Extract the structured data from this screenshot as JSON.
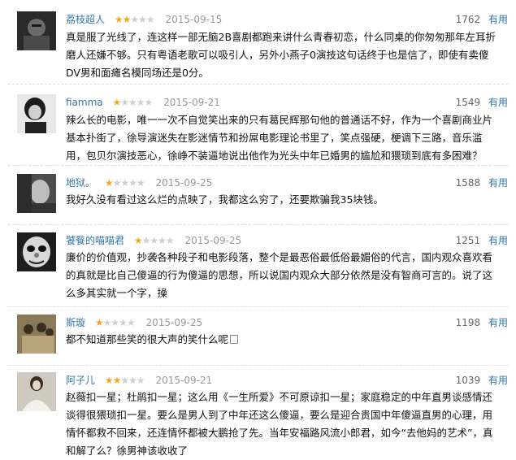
{
  "reviews": [
    {
      "user": "荔枝超人",
      "rating": 2,
      "date": "2015-09-15",
      "votes": "1762",
      "useful": "有用",
      "text": "真是服了光线了，连这样一部无脑2B喜剧都跑来讲什么青春初恋，什么同桌的你匆匆那年左耳折磨人还嫌不够。只有粤语老歌可以吸引人，另外小燕子0演技这句话终于也是信了，即使有卖傻DV男和面瘫名模同场还是0分。"
    },
    {
      "user": "fiamma",
      "rating": 1,
      "date": "2015-09-21",
      "votes": "1549",
      "useful": "有用",
      "text": "辣么长的电影，唯一一次不自觉笑出来的只有葛民辉那句他的普通话不好，作为一个喜剧商业片基本扑街了，徐导演迷失在影迷情节和扮屌电影理论书里了，笑点强硬，梗调下三路，音乐滥用，包贝尔演技恶心，徐峥不装逼地说出他作为光头中年已婚男的尴尬和猥琐到底有多困难？"
    },
    {
      "user": "地狱。",
      "rating": 1,
      "date": "2015-09-25",
      "votes": "1588",
      "useful": "有用",
      "text": "我好久没有看过这么烂的点映了，我都这么穷了，还要欺骗我35块钱。"
    },
    {
      "user": "饕餮的喵喵君",
      "rating": 1,
      "date": "2015-09-25",
      "votes": "1251",
      "useful": "有用",
      "text": "廉价的价值观，抄袭各种段子和电影段落，整个是最恶俗最低俗最媚俗的代言，国内观众喜欢看的真就是比自己傻逼的行为傻逼的思想，所以说国内观众大部分依然是没有智商可言的。说了这么多其实就一个字，操"
    },
    {
      "user": "斯璇",
      "rating": 1,
      "date": "2015-09-25",
      "votes": "1198",
      "useful": "有用",
      "text": "都不知道那些笑的很大声的笑什么呢"
    },
    {
      "user": "阿子儿",
      "rating": 2,
      "date": "2015-09-21",
      "votes": "1039",
      "useful": "有用",
      "text": "赵薇扣一星；杜鹃扣一星；这么用《一生所爱》不可原谅扣一星；家庭稳定的中年直男谈感情还谈得很猥琐扣一星。要么是男人到了中年还这么傻逼，要么是迎合贵国中年傻逼直男的心理，用情怀都救不回来，还连情怀都被大鹏抢了先。当年安福路风流小郎君，如今“去他妈的艺术”，真和解了么？徐男神该收收了"
    }
  ],
  "colors": {
    "link": "#3377aa",
    "star_on": "#f5a623",
    "star_off": "#cfcfcf",
    "date": "#999999"
  },
  "icons": {
    "star": "star-icon",
    "avatar": "avatar"
  }
}
